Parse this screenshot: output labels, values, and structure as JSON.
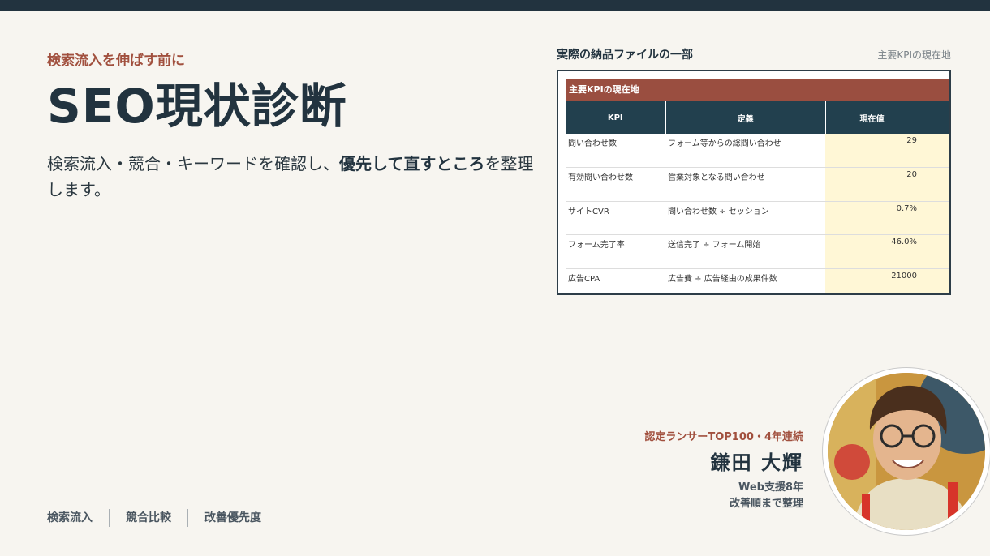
{
  "eyebrow": "検索流入を伸ばす前に",
  "headline": "SEO現状診断",
  "lead": {
    "part1": "検索流入・競合・キーワードを確認し、",
    "emphasis": "優先して直すところ",
    "part2": "を整理します。"
  },
  "tags": [
    "検索流入",
    "競合比較",
    "改善優先度"
  ],
  "document": {
    "label": "実際の納品ファイルの一部",
    "sublabel": "主要KPIの現在地",
    "sheet_title": "主要KPIの現在地",
    "columns": [
      "KPI",
      "定義",
      "現在値"
    ],
    "rows": [
      {
        "kpi": "問い合わせ数",
        "definition": "フォーム等からの総問い合わせ",
        "value": "29"
      },
      {
        "kpi": "有効問い合わせ数",
        "definition": "営業対象となる問い合わせ",
        "value": "20"
      },
      {
        "kpi": "サイトCVR",
        "definition": "問い合わせ数 ÷ セッション",
        "value": "0.7%"
      },
      {
        "kpi": "フォーム完了率",
        "definition": "送信完了 ÷ フォーム開始",
        "value": "46.0%"
      },
      {
        "kpi": "広告CPA",
        "definition": "広告費 ÷ 広告経由の成果件数",
        "value": "21000"
      }
    ]
  },
  "profile": {
    "credential": "認定ランサーTOP100・4年連続",
    "name": "鎌田 大輝",
    "note1": "Web支援8年",
    "note2": "改善順まで整理"
  },
  "colors": {
    "accent": "#a1503e",
    "navy": "#22333f",
    "background": "#f7f5f0",
    "header_cell": "#22404e",
    "value_cell": "#fff7d6"
  }
}
